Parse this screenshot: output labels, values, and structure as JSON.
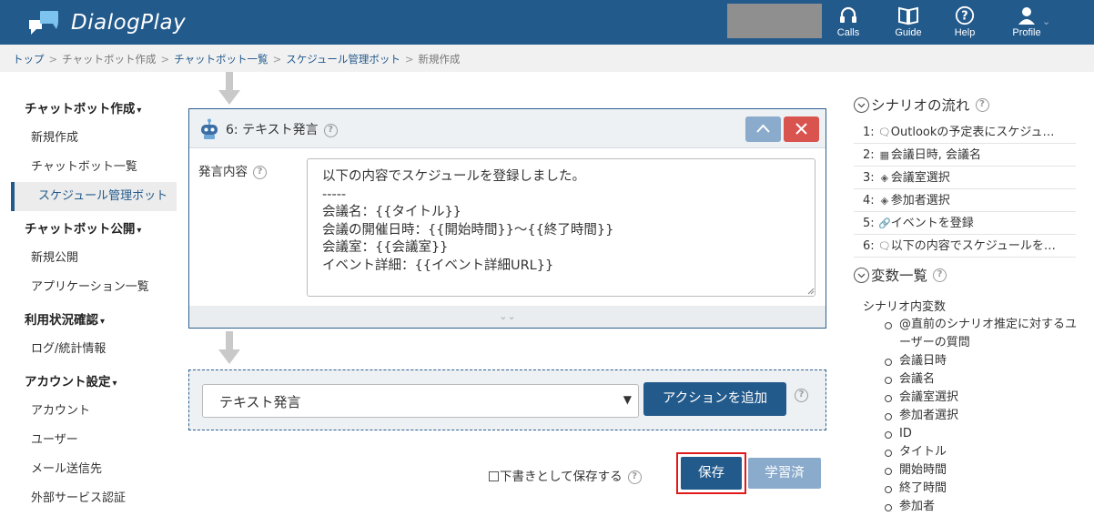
{
  "app": {
    "name": "DialogPlay"
  },
  "header": {
    "nav": [
      {
        "label": "Calls",
        "icon": "headset-icon"
      },
      {
        "label": "Guide",
        "icon": "book-icon"
      },
      {
        "label": "Help",
        "icon": "question-icon"
      },
      {
        "label": "Profile",
        "icon": "user-icon"
      }
    ]
  },
  "breadcrumb": {
    "items": [
      "トップ",
      "チャットボット作成",
      "チャットボット一覧",
      "スケジュール管理ボット",
      "新規作成"
    ],
    "separator": ">"
  },
  "sidebar": {
    "sections": [
      {
        "title": "チャットボット作成",
        "items": [
          "新規作成",
          "チャットボット一覧",
          "スケジュール管理ボット"
        ]
      },
      {
        "title": "チャットボット公開",
        "items": [
          "新規公開",
          "アプリケーション一覧"
        ]
      },
      {
        "title": "利用状況確認",
        "items": [
          "ログ/統計情報"
        ]
      },
      {
        "title": "アカウント設定",
        "items": [
          "アカウント",
          "ユーザー",
          "メール送信先",
          "外部サービス認証"
        ]
      }
    ],
    "active_item": "スケジュール管理ボット"
  },
  "card": {
    "title": "6: テキスト発言",
    "field_label": "発言内容",
    "text": "以下の内容でスケジュールを登録しました。\n-----\n会議名：{{タイトル}}\n会議の開催日時：{{開始時間}}～{{終了時間}}\n会議室：{{会議室}}\nイベント詳細：{{イベント詳細URL}}"
  },
  "action": {
    "selected": "テキスト発言",
    "add_button": "アクションを追加"
  },
  "footer": {
    "draft_label": "下書きとして保存する",
    "draft_checked": false,
    "save_button": "保存",
    "learned_button": "学習済"
  },
  "right": {
    "flow_title": "シナリオの流れ",
    "flow": [
      {
        "num": "1:",
        "icon": "chat-bubble-icon",
        "text": "Outlookの予定表にスケジュ…"
      },
      {
        "num": "2:",
        "icon": "calendar-icon",
        "text": "会議日時, 会議名"
      },
      {
        "num": "3:",
        "icon": "select-icon",
        "text": "会議室選択"
      },
      {
        "num": "4:",
        "icon": "select-icon",
        "text": "参加者選択"
      },
      {
        "num": "5:",
        "icon": "link-icon",
        "text": "イベントを登録"
      },
      {
        "num": "6:",
        "icon": "chat-bubble-icon",
        "text": "以下の内容でスケジュールを…"
      }
    ],
    "vars_title": "変数一覧",
    "vars_subtitle": "シナリオ内変数",
    "vars": [
      "@直前のシナリオ推定に対するユーザーの質問",
      "会議日時",
      "会議名",
      "会議室選択",
      "参加者選択",
      "ID",
      "タイトル",
      "開始時間",
      "終了時間",
      "参加者"
    ]
  },
  "colors": {
    "header": "#235a8c",
    "primary": "#235a8c",
    "muted_button": "#8aabcb",
    "danger": "#d9534f",
    "highlight": "#e0191b"
  }
}
